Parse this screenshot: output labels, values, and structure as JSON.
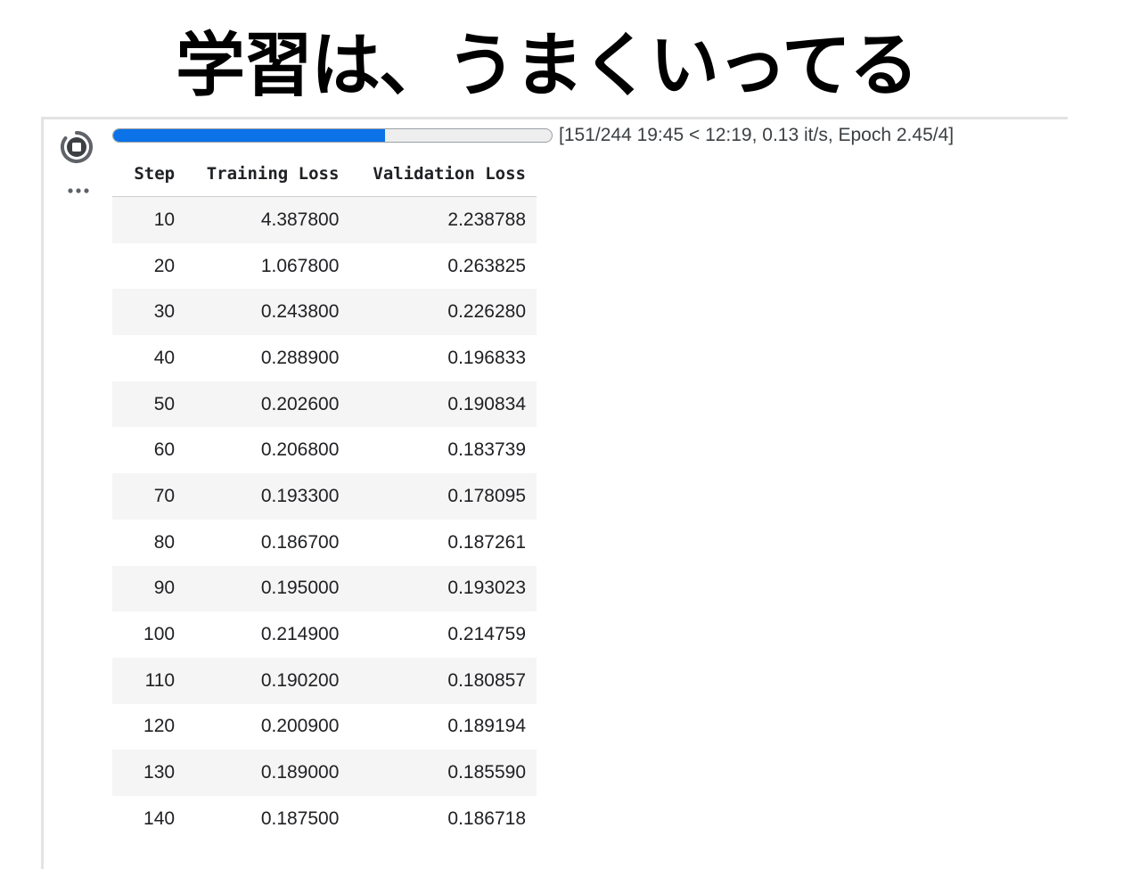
{
  "slide": {
    "title": "学習は、うまくいってる"
  },
  "cell": {
    "run_icon": "stop-circle-icon",
    "more_icon": "more-horiz-icon"
  },
  "progress": {
    "fraction": 0.619,
    "text": "[151/244 19:45 < 12:19, 0.13 it/s, Epoch 2.45/4]",
    "fill_color": "#0b72e7"
  },
  "table": {
    "headers": [
      "Step",
      "Training Loss",
      "Validation Loss"
    ],
    "rows": [
      [
        "10",
        "4.387800",
        "2.238788"
      ],
      [
        "20",
        "1.067800",
        "0.263825"
      ],
      [
        "30",
        "0.243800",
        "0.226280"
      ],
      [
        "40",
        "0.288900",
        "0.196833"
      ],
      [
        "50",
        "0.202600",
        "0.190834"
      ],
      [
        "60",
        "0.206800",
        "0.183739"
      ],
      [
        "70",
        "0.193300",
        "0.178095"
      ],
      [
        "80",
        "0.186700",
        "0.187261"
      ],
      [
        "90",
        "0.195000",
        "0.193023"
      ],
      [
        "100",
        "0.214900",
        "0.214759"
      ],
      [
        "110",
        "0.190200",
        "0.180857"
      ],
      [
        "120",
        "0.200900",
        "0.189194"
      ],
      [
        "130",
        "0.189000",
        "0.185590"
      ],
      [
        "140",
        "0.187500",
        "0.186718"
      ]
    ]
  }
}
